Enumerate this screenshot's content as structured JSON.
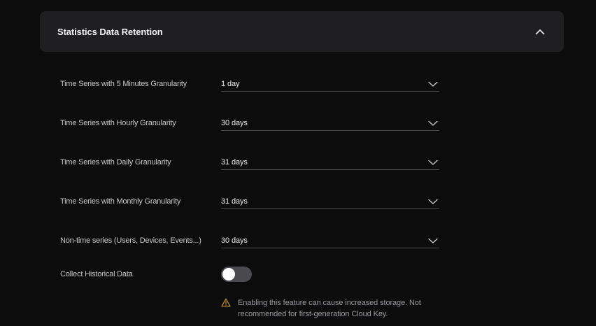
{
  "section": {
    "title": "Statistics Data Retention"
  },
  "rows": [
    {
      "label": "Time Series with 5 Minutes Granularity",
      "value": "1 day"
    },
    {
      "label": "Time Series with Hourly Granularity",
      "value": "30 days"
    },
    {
      "label": "Time Series with Daily Granularity",
      "value": "31 days"
    },
    {
      "label": "Time Series with Monthly Granularity",
      "value": "31 days"
    },
    {
      "label": "Non-time series (Users, Devices, Events...)",
      "value": "30 days"
    }
  ],
  "historical": {
    "label": "Collect Historical Data",
    "enabled": false,
    "warning": "Enabling this feature can cause increased storage. Not recommended for first-generation Cloud Key."
  },
  "colors": {
    "background": "#0c0c0d",
    "header_bg": "#1f1f22",
    "toggle_off": "#4a4a4f",
    "warning_icon": "#c8962c"
  },
  "icons": {
    "collapse": "chevron-up-icon",
    "select": "chevron-down-icon",
    "warning": "warning-triangle-icon"
  }
}
